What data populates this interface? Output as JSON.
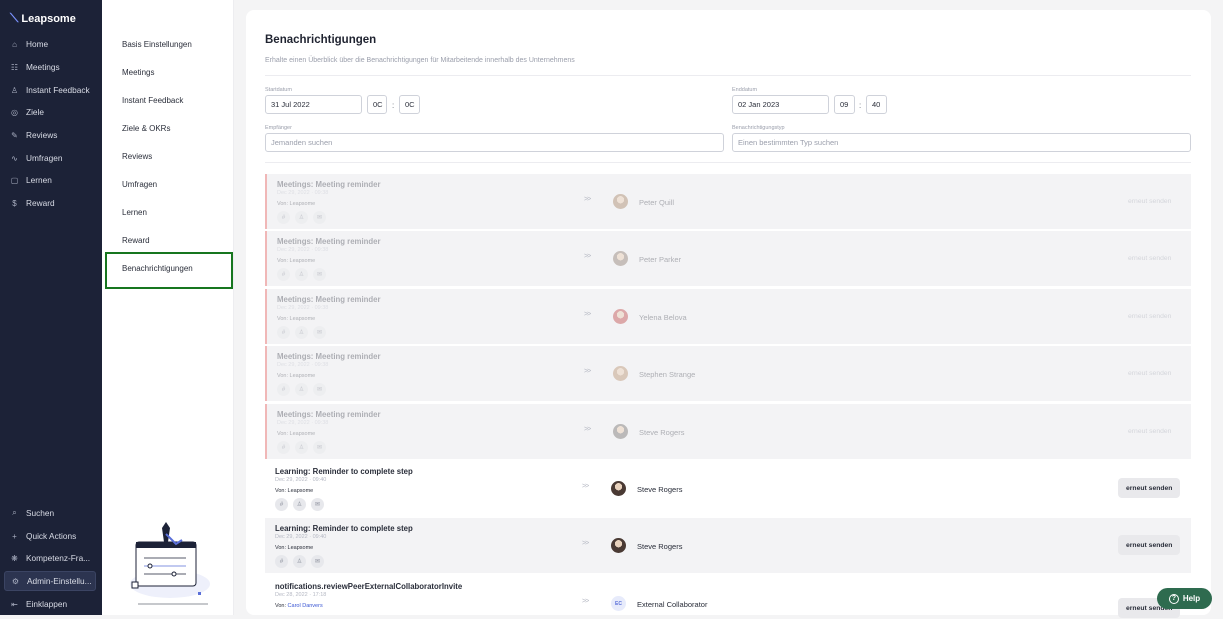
{
  "app": {
    "logo": "Leapsome"
  },
  "nav": {
    "items": [
      {
        "label": "Home",
        "icon": "⌂"
      },
      {
        "label": "Meetings",
        "icon": "☷"
      },
      {
        "label": "Instant Feedback",
        "icon": "♙"
      },
      {
        "label": "Ziele",
        "icon": "◎"
      },
      {
        "label": "Reviews",
        "icon": "✎"
      },
      {
        "label": "Umfragen",
        "icon": "∿"
      },
      {
        "label": "Lernen",
        "icon": "▢"
      },
      {
        "label": "Reward",
        "icon": "$"
      }
    ],
    "bottom": [
      {
        "label": "Suchen",
        "icon": "⌕"
      },
      {
        "label": "Quick Actions",
        "icon": "+"
      },
      {
        "label": "Kompetenz-Fra...",
        "icon": "❋"
      },
      {
        "label": "Admin-Einstellu...",
        "icon": "⚙"
      },
      {
        "label": "Einklappen",
        "icon": "⇤"
      }
    ]
  },
  "subnav": {
    "items": [
      "Basis Einstellungen",
      "Meetings",
      "Instant Feedback",
      "Ziele & OKRs",
      "Reviews",
      "Umfragen",
      "Lernen",
      "Reward",
      "Benachrichtigungen"
    ]
  },
  "page": {
    "title": "Benachrichtigungen",
    "subtitle": "Erhalte einen Überblick über die Benachrichtigungen für Mitarbeitende innerhalb des Unternehmens"
  },
  "filters": {
    "start_label": "Startdatum",
    "start_date": "31 Jul 2022",
    "start_hour": "0C",
    "start_min": "0C",
    "end_label": "Enddatum",
    "end_date": "02 Jan 2023",
    "end_hour": "09",
    "end_min": "40",
    "time_sep": ":",
    "recipient_label": "Empfänger",
    "recipient_placeholder": "Jemanden suchen",
    "type_label": "Benachrichtigungstyp",
    "type_placeholder": "Einen bestimmten Typ suchen"
  },
  "rows": [
    {
      "title": "Meetings: Meeting reminder",
      "date": "Dec 29, 2022 · 09:38",
      "from_prefix": "Von:",
      "from": "Leapsome",
      "arrow": ">>",
      "name": "Peter Quill",
      "action": "erneut senden",
      "color": "#b59a82"
    },
    {
      "title": "Meetings: Meeting reminder",
      "date": "Dec 29, 2022 · 09:38",
      "from_prefix": "Von:",
      "from": "Leapsome",
      "arrow": ">>",
      "name": "Peter Parker",
      "action": "erneut senden",
      "color": "#a19389"
    },
    {
      "title": "Meetings: Meeting reminder",
      "date": "Dec 29, 2022 · 09:38",
      "from_prefix": "Von:",
      "from": "Leapsome",
      "arrow": ">>",
      "name": "Yelena Belova",
      "action": "erneut senden",
      "color": "#c96b6b"
    },
    {
      "title": "Meetings: Meeting reminder",
      "date": "Dec 29, 2022 · 09:38",
      "from_prefix": "Von:",
      "from": "Leapsome",
      "arrow": ">>",
      "name": "Stephen Strange",
      "action": "erneut senden",
      "color": "#c4a48a"
    },
    {
      "title": "Meetings: Meeting reminder",
      "date": "Dec 29, 2022 · 09:38",
      "from_prefix": "Von:",
      "from": "Leapsome",
      "arrow": ">>",
      "name": "Steve Rogers",
      "action": "erneut senden",
      "color": "#8d8a88"
    },
    {
      "title": "Learning: Reminder to complete step",
      "date": "Dec 29, 2022 · 09:40",
      "from_prefix": "Von:",
      "from": "Leapsome",
      "arrow": ">>",
      "name": "Steve Rogers",
      "action": "erneut senden",
      "color": "#4a3a34"
    },
    {
      "title": "Learning: Reminder to complete step",
      "date": "Dec 29, 2022 · 09:40",
      "from_prefix": "Von:",
      "from": "Leapsome",
      "arrow": ">>",
      "name": "Steve Rogers",
      "action": "erneut senden",
      "color": "#4a3a34"
    },
    {
      "title": "notifications.reviewPeerExternalCollaboratorInvite",
      "date": "Dec 28, 2022 · 17:18",
      "from_prefix": "Von:",
      "from": "Carol Danvers",
      "arrow": ">>",
      "name": "External Collaborator",
      "action": "erneut senden",
      "initials": "EC"
    }
  ],
  "help": {
    "label": "Help",
    "icon": "?"
  }
}
